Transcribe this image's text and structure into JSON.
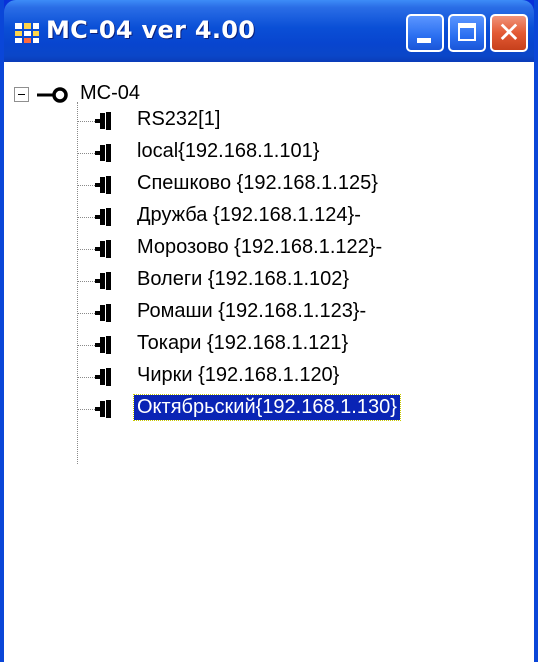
{
  "window": {
    "title": "MC-04  ver 4.00",
    "app_icon": "network-app-icon",
    "buttons": {
      "minimize": "minimize-icon",
      "maximize": "maximize-icon",
      "close": "close-icon",
      "close_glyph": "✕"
    }
  },
  "tree": {
    "root": {
      "label": "MC-04",
      "expanded": true,
      "icon": "key-icon"
    },
    "selected_index": 9,
    "children": [
      {
        "label": "RS232[1]"
      },
      {
        "label": "local{192.168.1.101}"
      },
      {
        "label": "Спешково  {192.168.1.125}"
      },
      {
        "label": "Дружба {192.168.1.124}-"
      },
      {
        "label": "Морозово {192.168.1.122}-"
      },
      {
        "label": "Волеги {192.168.1.102}"
      },
      {
        "label": "Ромаши {192.168.1.123}-"
      },
      {
        "label": "Токари {192.168.1.121}"
      },
      {
        "label": "Чирки {192.168.1.120}"
      },
      {
        "label": "Октябрьский{192.168.1.130}"
      }
    ]
  },
  "colors": {
    "titlebar": "#0a4fd6",
    "selection": "#0a24b5",
    "close_button": "#e35a34"
  }
}
